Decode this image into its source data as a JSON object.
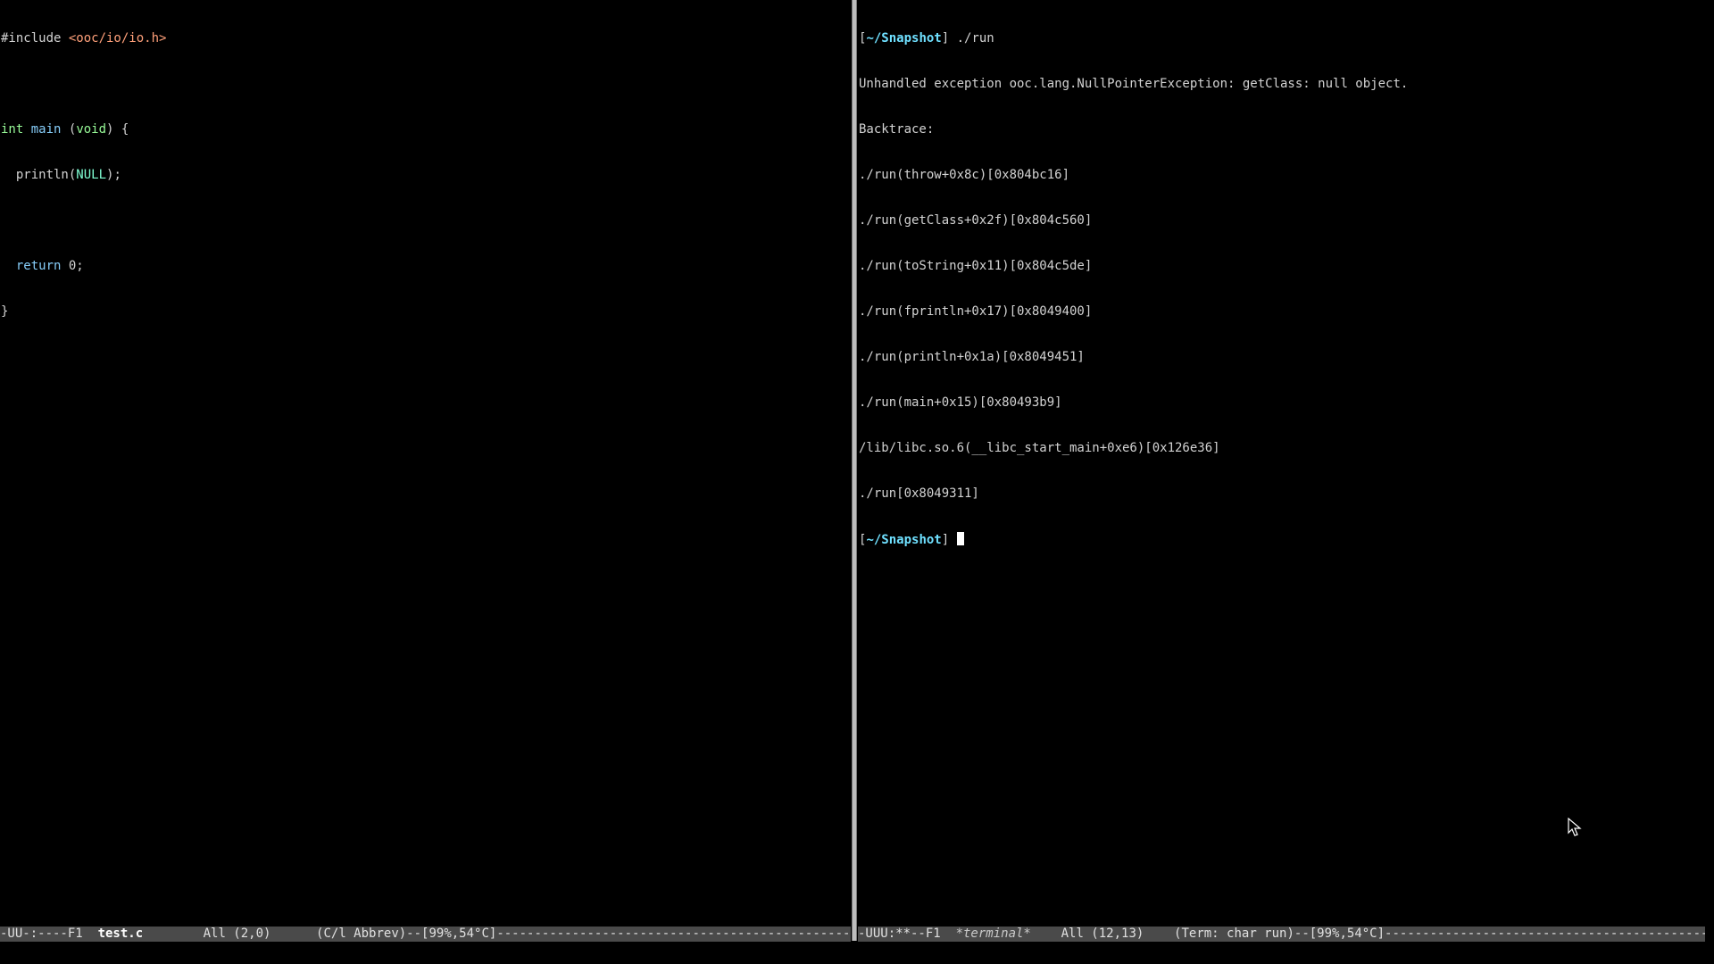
{
  "editor": {
    "lines": [
      {
        "preproc": "#include ",
        "header": "<ooc/io/io.h>"
      },
      {},
      {
        "type": "int",
        "sp1": " ",
        "func": "main",
        "sp2": " (",
        "arg": "void",
        "rest": ") {"
      },
      {
        "indent": "  ",
        "call": "println(",
        "const": "NULL",
        "end": ");"
      },
      {},
      {
        "indent": "  ",
        "kw": "return",
        "rest": " 0;"
      },
      {
        "rest": "}"
      }
    ],
    "modeline": {
      "status": "-UU-:----F1  ",
      "buffer": "test.c",
      "gap": "        ",
      "position": "All (2,0)",
      "gap2": "      ",
      "mode": "(C/l Abbrev)--[99%,54°C]----------------------------------------------------------------------"
    }
  },
  "terminal": {
    "prompt_open": "[",
    "prompt_path": "~/Snapshot",
    "prompt_close": "] ",
    "command": "./run",
    "output": [
      "Unhandled exception ooc.lang.NullPointerException: getClass: null object.",
      "Backtrace:",
      "./run(throw+0x8c)[0x804bc16]",
      "./run(getClass+0x2f)[0x804c560]",
      "./run(toString+0x11)[0x804c5de]",
      "./run(fprintln+0x17)[0x8049400]",
      "./run(println+0x1a)[0x8049451]",
      "./run(main+0x15)[0x80493b9]",
      "/lib/libc.so.6(__libc_start_main+0xe6)[0x126e36]",
      "./run[0x8049311]"
    ],
    "modeline": {
      "status": "-UUU:**--F1  ",
      "buffer": "*terminal*",
      "gap": "    ",
      "position": "All (12,13)",
      "gap2": "    ",
      "mode": "(Term: char run)--[99%,54°C]----------------------------------------------------------------------------"
    }
  },
  "colors": {
    "background": "#000000",
    "text": "#d3d3d3",
    "string": "#ffa07a",
    "type": "#98fb98",
    "keyword": "#87cefa",
    "prompt": "#6fe0ff",
    "modeline_bg": "#4a4a4a"
  }
}
